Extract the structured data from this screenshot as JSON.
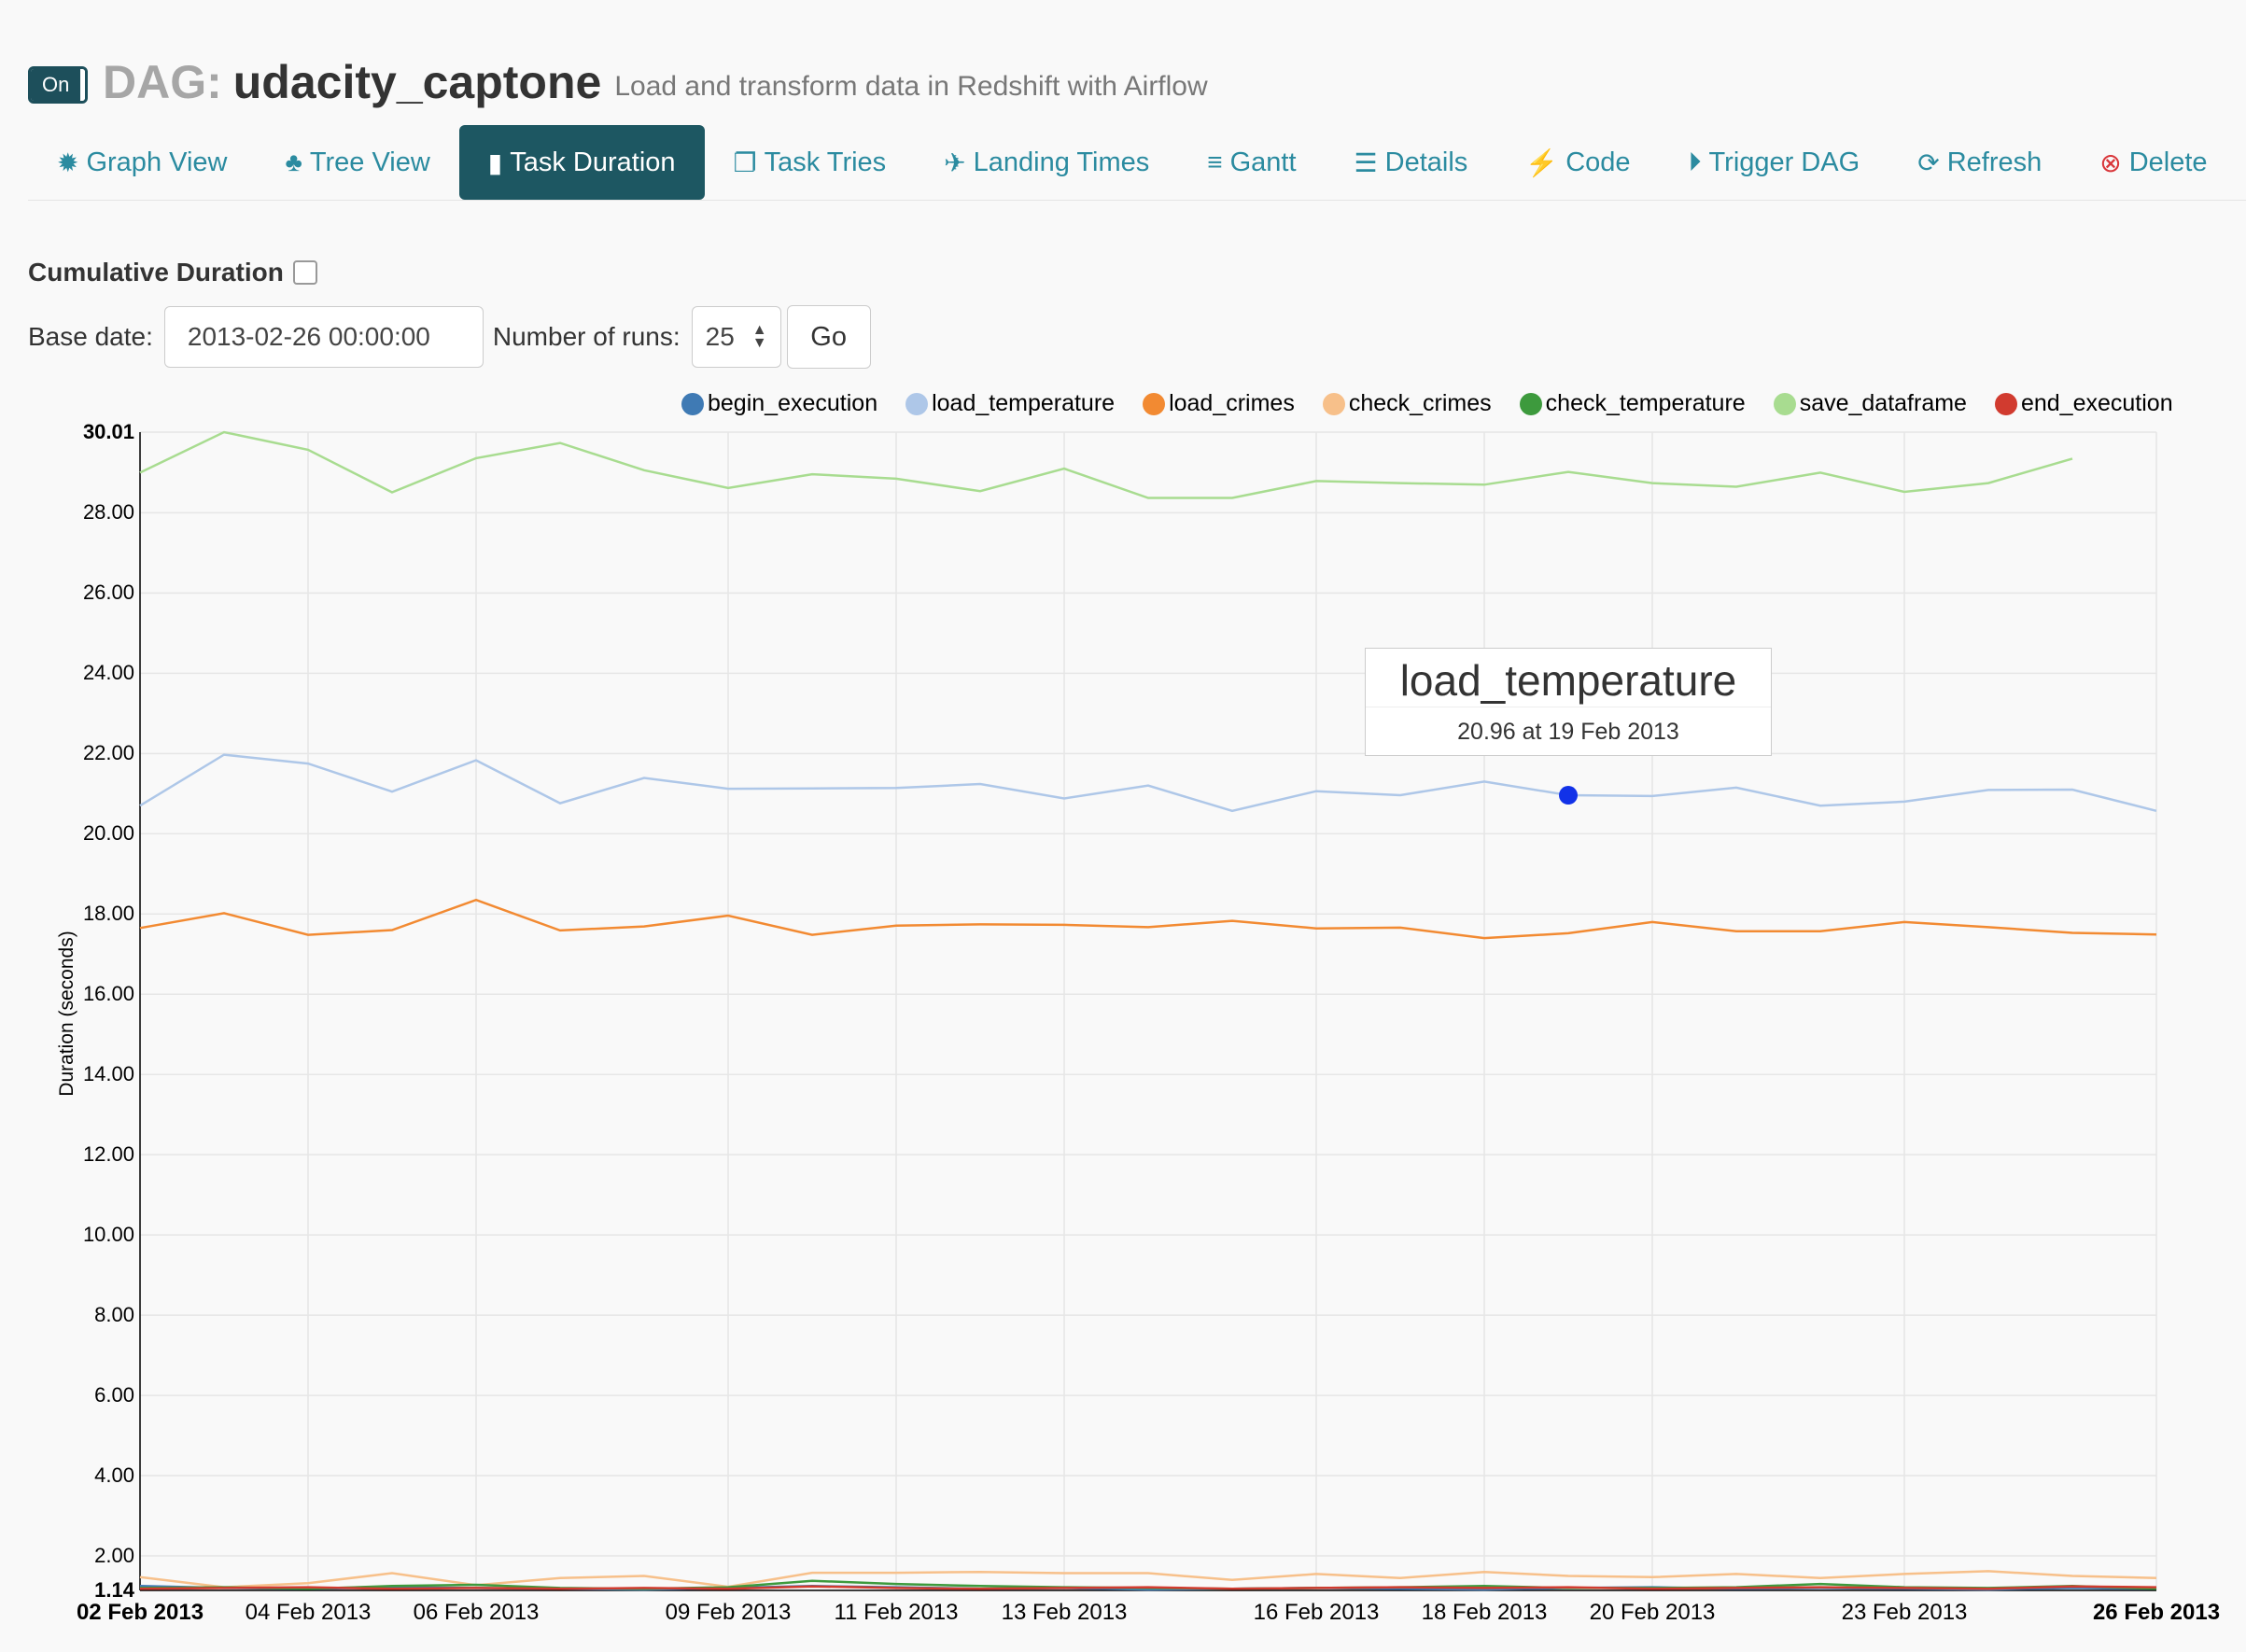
{
  "header": {
    "toggle_label": "On",
    "dag_prefix": "DAG:",
    "dag_name": "udacity_captone",
    "description": "Load and transform data in Redshift with Airflow"
  },
  "nav": {
    "tabs": [
      {
        "label": "Graph View",
        "icon": "gear-icon",
        "glyph": "✹"
      },
      {
        "label": "Tree View",
        "icon": "tree-icon",
        "glyph": "♣"
      },
      {
        "label": "Task Duration",
        "icon": "bar-chart-icon",
        "glyph": "▮",
        "active": true
      },
      {
        "label": "Task Tries",
        "icon": "files-icon",
        "glyph": "❐"
      },
      {
        "label": "Landing Times",
        "icon": "plane-icon",
        "glyph": "✈"
      },
      {
        "label": "Gantt",
        "icon": "align-left-icon",
        "glyph": "≡"
      },
      {
        "label": "Details",
        "icon": "list-icon",
        "glyph": "☰"
      },
      {
        "label": "Code",
        "icon": "bolt-icon",
        "glyph": "⚡"
      },
      {
        "label": "Trigger DAG",
        "icon": "play-circle-icon",
        "glyph": "⏵"
      },
      {
        "label": "Refresh",
        "icon": "refresh-icon",
        "glyph": "⟳"
      },
      {
        "label": "Delete",
        "icon": "delete-circle-icon",
        "glyph": "⊗"
      }
    ]
  },
  "controls": {
    "cumulative_label": "Cumulative Duration",
    "cumulative_checked": false,
    "base_date_label": "Base date:",
    "base_date_value": "2013-02-26 00:00:00",
    "runs_label": "Number of runs:",
    "runs_value": "25",
    "go_label": "Go"
  },
  "tooltip": {
    "title": "load_temperature",
    "value": "20.96 at 19 Feb 2013",
    "point": {
      "x": "19 Feb 2013",
      "y": 20.96
    }
  },
  "chart_data": {
    "type": "line",
    "xlabel": "",
    "ylabel": "Duration (seconds)",
    "ylim": [
      1.14,
      30.01
    ],
    "y_ticks": [
      "1.14",
      "2.00",
      "4.00",
      "6.00",
      "8.00",
      "10.00",
      "12.00",
      "14.00",
      "16.00",
      "18.00",
      "20.00",
      "22.00",
      "24.00",
      "26.00",
      "28.00",
      "30.01"
    ],
    "x_ticks": [
      "02 Feb 2013",
      "04 Feb 2013",
      "06 Feb 2013",
      "09 Feb 2013",
      "11 Feb 2013",
      "13 Feb 2013",
      "16 Feb 2013",
      "18 Feb 2013",
      "20 Feb 2013",
      "23 Feb 2013",
      "26 Feb 2013"
    ],
    "x": [
      "02 Feb 2013",
      "03 Feb 2013",
      "04 Feb 2013",
      "05 Feb 2013",
      "06 Feb 2013",
      "07 Feb 2013",
      "08 Feb 2013",
      "09 Feb 2013",
      "10 Feb 2013",
      "11 Feb 2013",
      "12 Feb 2013",
      "13 Feb 2013",
      "14 Feb 2013",
      "15 Feb 2013",
      "16 Feb 2013",
      "17 Feb 2013",
      "18 Feb 2013",
      "19 Feb 2013",
      "20 Feb 2013",
      "21 Feb 2013",
      "22 Feb 2013",
      "23 Feb 2013",
      "24 Feb 2013",
      "25 Feb 2013",
      "26 Feb 2013"
    ],
    "grid": true,
    "legend": "top",
    "series": [
      {
        "name": "begin_execution",
        "color": "#3f7ab4",
        "values": [
          1.25,
          1.2,
          1.18,
          1.22,
          1.2,
          1.18,
          1.16,
          1.2,
          1.25,
          1.22,
          1.18,
          1.2,
          1.16,
          1.18,
          1.2,
          1.18,
          1.16,
          1.2,
          1.22,
          1.18,
          1.2,
          1.18,
          1.16,
          1.2,
          1.18
        ]
      },
      {
        "name": "load_temperature",
        "color": "#aec7e8",
        "values": [
          20.7,
          21.97,
          21.75,
          21.05,
          21.83,
          20.76,
          21.39,
          21.12,
          21.13,
          21.14,
          21.24,
          20.88,
          21.2,
          20.57,
          21.06,
          20.96,
          21.3,
          20.96,
          20.94,
          21.15,
          20.7,
          20.8,
          21.09,
          21.1,
          20.57
        ]
      },
      {
        "name": "load_crimes",
        "color": "#f28a32",
        "values": [
          17.65,
          18.02,
          17.48,
          17.6,
          18.35,
          17.59,
          17.69,
          17.96,
          17.48,
          17.71,
          17.74,
          17.73,
          17.67,
          17.83,
          17.64,
          17.66,
          17.4,
          17.52,
          17.8,
          17.57,
          17.57,
          17.8,
          17.67,
          17.53,
          17.49
        ]
      },
      {
        "name": "check_crimes",
        "color": "#f7c08a",
        "values": [
          1.47,
          1.22,
          1.32,
          1.57,
          1.27,
          1.45,
          1.5,
          1.23,
          1.58,
          1.58,
          1.6,
          1.57,
          1.57,
          1.4,
          1.55,
          1.45,
          1.6,
          1.5,
          1.47,
          1.55,
          1.45,
          1.55,
          1.62,
          1.5,
          1.45
        ]
      },
      {
        "name": "check_temperature",
        "color": "#3d9a3d",
        "values": [
          1.2,
          1.22,
          1.18,
          1.25,
          1.28,
          1.2,
          1.18,
          1.22,
          1.38,
          1.3,
          1.25,
          1.22,
          1.2,
          1.18,
          1.2,
          1.22,
          1.25,
          1.2,
          1.2,
          1.22,
          1.3,
          1.22,
          1.2,
          1.25,
          1.18
        ]
      },
      {
        "name": "save_dataframe",
        "color": "#a8dc90",
        "values": [
          29.0,
          30.01,
          29.57,
          28.51,
          29.36,
          29.74,
          29.06,
          28.62,
          28.96,
          28.85,
          28.54,
          29.1,
          28.37,
          28.37,
          28.79,
          28.74,
          28.7,
          29.02,
          28.74,
          28.65,
          29.0,
          28.52,
          28.74,
          29.35,
          null
        ]
      },
      {
        "name": "end_execution",
        "color": "#d13b2f",
        "values": [
          1.18,
          1.2,
          1.22,
          1.18,
          1.2,
          1.18,
          1.2,
          1.18,
          1.24,
          1.2,
          1.18,
          1.2,
          1.22,
          1.18,
          1.2,
          1.22,
          1.2,
          1.22,
          1.18,
          1.2,
          1.22,
          1.2,
          1.18,
          1.24,
          1.22
        ]
      }
    ]
  }
}
